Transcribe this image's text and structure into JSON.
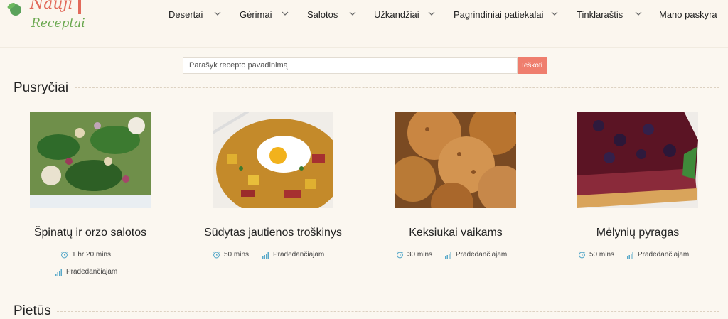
{
  "header": {
    "logo_line1": "Nauji",
    "logo_line2": "Receptai",
    "nav": [
      {
        "label": "Desertai"
      },
      {
        "label": "Gėrimai"
      },
      {
        "label": "Salotos"
      },
      {
        "label": "Užkandžiai"
      },
      {
        "label": "Pagrindiniai patiekalai"
      },
      {
        "label": "Tinklaraštis"
      },
      {
        "label": "Mano paskyra"
      }
    ]
  },
  "search": {
    "placeholder": "Parašyk recepto pavadinimą",
    "button_label": "Ieškoti"
  },
  "sections": [
    {
      "title": "Pusryčiai",
      "recipes": [
        {
          "title": "Špinatų ir orzo salotos",
          "time": "1 hr 20 mins",
          "level": "Pradedančiajam"
        },
        {
          "title": "Sūdytas jautienos troškinys",
          "time": "50 mins",
          "level": "Pradedančiajam"
        },
        {
          "title": "Keksiukai vaikams",
          "time": "30 mins",
          "level": "Pradedančiajam"
        },
        {
          "title": "Mėlynių pyragas",
          "time": "50 mins",
          "level": "Pradedančiajam"
        }
      ]
    },
    {
      "title": "Pietūs"
    }
  ],
  "colors": {
    "accent": "#ef7e6e",
    "icon": "#58a9c9",
    "background": "#fbf7f0"
  },
  "icons": {
    "time": "alarm-clock-icon",
    "level": "signal-bars-icon",
    "dropdown": "chevron-down-icon"
  }
}
